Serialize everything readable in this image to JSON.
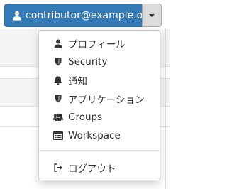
{
  "header": {
    "user_label": "contributor@example.org"
  },
  "menu": {
    "items": [
      {
        "label": "プロフィール",
        "icon": "user-icon"
      },
      {
        "label": "Security",
        "icon": "shield-icon"
      },
      {
        "label": "通知",
        "icon": "bell-icon"
      },
      {
        "label": "アプリケーション",
        "icon": "shield-icon"
      },
      {
        "label": "Groups",
        "icon": "users-icon"
      },
      {
        "label": "Workspace",
        "icon": "workspace-icon"
      }
    ],
    "logout_label": "ログアウト"
  },
  "colors": {
    "primary": "#337ab7",
    "text": "#333333"
  }
}
